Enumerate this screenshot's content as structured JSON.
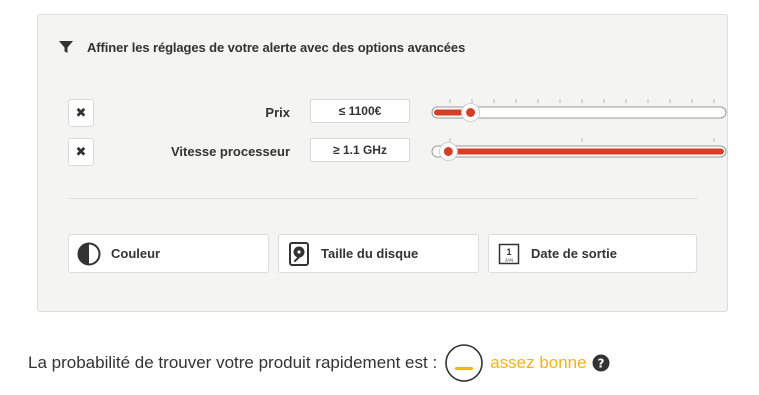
{
  "panel": {
    "title": "Affiner les réglages de votre alerte avec des options avancées",
    "filter_icon": "filter-icon"
  },
  "filters": [
    {
      "label": "Prix",
      "value": "≤ 1100€",
      "remove_icon": "close-icon",
      "remove_glyph": "✖",
      "slider": {
        "level": 0.11,
        "fill": "left",
        "ticks": 13
      }
    },
    {
      "label": "Vitesse processeur",
      "value": "≥ 1.1 GHz",
      "remove_icon": "close-icon",
      "remove_glyph": "✖",
      "slider": {
        "level": 0.03,
        "fill": "right",
        "ticks": 3
      }
    }
  ],
  "options": [
    {
      "label": "Couleur",
      "icon": "contrast-icon"
    },
    {
      "label": "Taille du disque",
      "icon": "hard-disk-icon"
    },
    {
      "label": "Date de sortie",
      "icon": "calendar-icon",
      "icon_day": "1",
      "icon_month": "JAN"
    }
  ],
  "probability": {
    "text": "La probabilité de trouver votre produit rapidement est :",
    "level_label": "assez bonne",
    "gauge_level": 0.5,
    "help_icon": "question-icon"
  },
  "colors": {
    "accent": "#d63f25",
    "level": "#f0b31a",
    "panel_bg": "#f4f4f3"
  }
}
